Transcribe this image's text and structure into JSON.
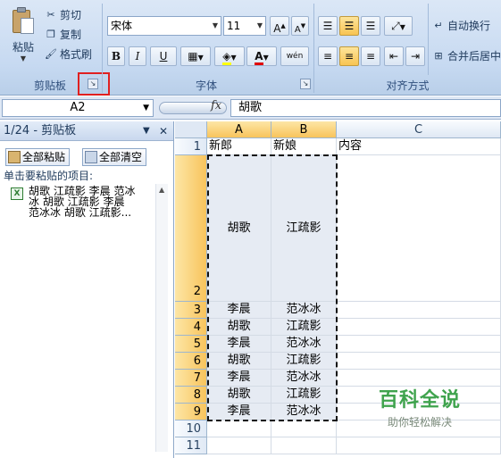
{
  "ribbon": {
    "clipboard": {
      "paste_label": "粘贴",
      "cut_label": "剪切",
      "copy_label": "复制",
      "format_painter_label": "格式刷",
      "group_label": "剪贴板"
    },
    "font": {
      "font_name": "宋体",
      "font_size": "11",
      "bold": "B",
      "italic": "I",
      "underline": "U",
      "phonetic": "wén",
      "group_label": "字体"
    },
    "alignment": {
      "wrap_text_label": "自动换行",
      "merge_center_label": "合并后居中",
      "group_label": "对齐方式"
    },
    "accent_color": "#f8c452",
    "highlight_color": "#e02020"
  },
  "formula_bar": {
    "name_box": "A2",
    "fx_label": "fx",
    "content": "胡歌"
  },
  "clipboard_pane": {
    "title": "1/24 - 剪贴板",
    "paste_all_label": "全部粘贴",
    "clear_all_label": "全部清空",
    "note": "单击要粘贴的项目:",
    "item_line1": "胡歌 江疏影 李晨 范冰",
    "item_line2": "冰 胡歌 江疏影 李晨",
    "item_line3": "范冰冰 胡歌 江疏影..."
  },
  "sheet": {
    "columns": [
      "A",
      "B",
      "C"
    ],
    "header_row": {
      "row": "1",
      "a": "新郎",
      "b": "新娘",
      "c": "内容"
    },
    "rows": [
      {
        "row": "2",
        "a": "胡歌",
        "b": "江疏影"
      },
      {
        "row": "3",
        "a": "李晨",
        "b": "范冰冰"
      },
      {
        "row": "4",
        "a": "胡歌",
        "b": "江疏影"
      },
      {
        "row": "5",
        "a": "李晨",
        "b": "范冰冰"
      },
      {
        "row": "6",
        "a": "胡歌",
        "b": "江疏影"
      },
      {
        "row": "7",
        "a": "李晨",
        "b": "范冰冰"
      },
      {
        "row": "8",
        "a": "胡歌",
        "b": "江疏影"
      },
      {
        "row": "9",
        "a": "李晨",
        "b": "范冰冰"
      },
      {
        "row": "10",
        "a": "",
        "b": ""
      },
      {
        "row": "11",
        "a": "",
        "b": ""
      }
    ]
  },
  "watermark": {
    "title": "百科全说",
    "subtitle": "助你轻松解决"
  }
}
